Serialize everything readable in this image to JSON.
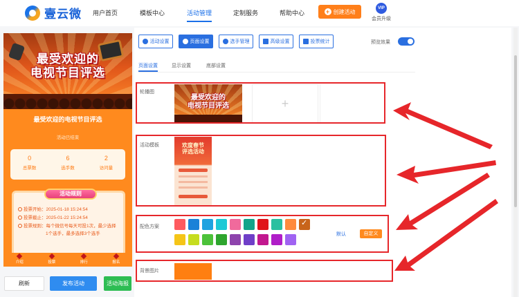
{
  "brand": {
    "name": "壹云微"
  },
  "nav": {
    "items": [
      "用户首页",
      "模板中心",
      "活动管理",
      "定制服务",
      "帮助中心"
    ],
    "active": "活动管理",
    "create_label": "创建活动",
    "vip_badge": "VIP",
    "vip_label": "会员升级"
  },
  "preview": {
    "banner_title_line1": "最受欢迎的",
    "banner_title_line2": "电视节目评选",
    "title": "最受欢迎的电视节目评选",
    "status": "活动已结束",
    "stats": [
      {
        "value": "0",
        "label": "总票数"
      },
      {
        "value": "6",
        "label": "选手数"
      },
      {
        "value": "2",
        "label": "访问量"
      }
    ],
    "rules_title": "活动规则",
    "rules": [
      "投票开始：2025-01-18 15:24:54",
      "投票截止：2025-01-22 15:24:54",
      "投票规则：每个微信号每天可投1次，最少选择",
      "1个选手，最多选择3个选手"
    ],
    "tabs": [
      "介绍",
      "投票",
      "排行",
      "报名"
    ]
  },
  "actions": {
    "refresh": "刷新",
    "publish": "发布活动",
    "poster": "活动海报"
  },
  "editor": {
    "toolbar": [
      "活动设置",
      "页面设置",
      "选手管理",
      "高级设置",
      "投票统计"
    ],
    "toolbar_active": "页面设置",
    "preview_toggle_label": "预览效果",
    "preview_toggle_on": true,
    "subtabs": [
      "页面设置",
      "显示设置",
      "底部设置"
    ],
    "subtab_active": "页面设置",
    "sections": {
      "carousel": {
        "label": "轮播图",
        "thumb_title_line1": "最受欢迎的",
        "thumb_title_line2": "电视节目评选",
        "add_symbol": "+"
      },
      "template": {
        "label": "活动模板",
        "thumb_title_line1": "欢度春节",
        "thumb_title_line2": "评选活动"
      },
      "colors": {
        "label": "配色方案",
        "row1": [
          "#ff5a5f",
          "#1a82d8",
          "#1fa3e0",
          "#1cc9d6",
          "#f06a9c",
          "#12a48a",
          "#e0141a",
          "#2bc0a0",
          "#ff8a3d",
          "#c8641a"
        ],
        "row2": [
          "#f5c518",
          "#c6dd1f",
          "#4cc23a",
          "#2ea52e",
          "#8e44ad",
          "#6f3fc8",
          "#c2188f",
          "#b01ec8",
          "#a063f2"
        ],
        "selected_index": 9,
        "default_label": "默认",
        "custom_label": "自定义"
      },
      "background": {
        "label": "背景图片",
        "color": "#ff7f11"
      }
    }
  },
  "annotations": {
    "color": "#e6262a"
  }
}
